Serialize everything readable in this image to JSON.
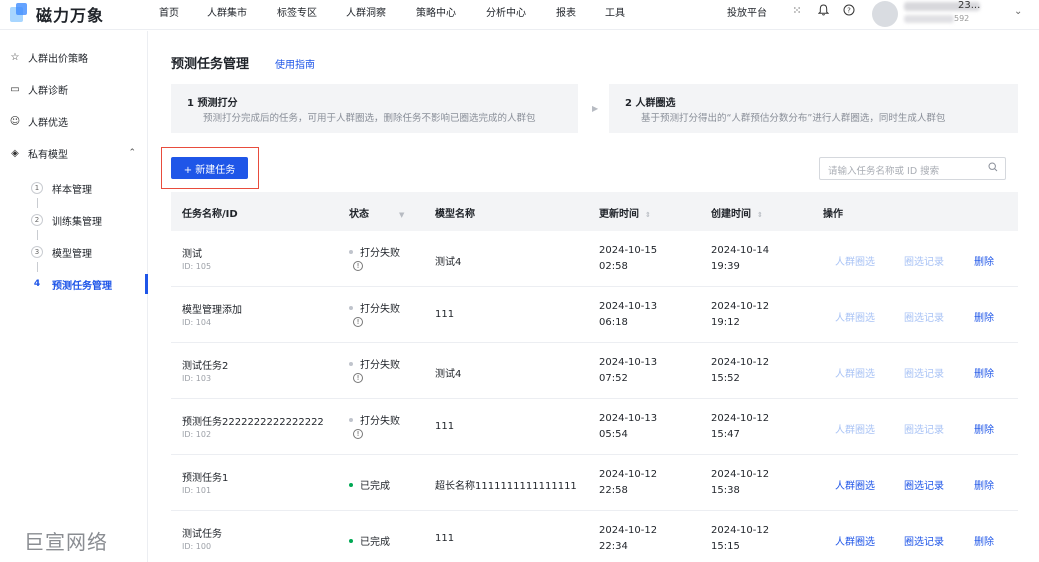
{
  "app": {
    "logo_text": "磁力万象"
  },
  "top_nav": {
    "items": [
      "首页",
      "人群集市",
      "标签专区",
      "人群洞察",
      "策略中心",
      "分析中心",
      "报表",
      "工具"
    ]
  },
  "top_right": {
    "platform_label": "投放平台",
    "icons": [
      "grid-icon",
      "bell-icon",
      "help-icon"
    ],
    "user_name_tail": "23...",
    "user_id_tail": "592"
  },
  "sidebar": {
    "items": [
      {
        "label": "人群出价策略",
        "icon": "strategy-icon"
      },
      {
        "label": "人群诊断",
        "icon": "diagnosis-icon"
      },
      {
        "label": "人群优选",
        "icon": "people-icon"
      },
      {
        "label": "私有模型",
        "icon": "layers-icon"
      }
    ],
    "sub_items": [
      {
        "num": "1",
        "label": "样本管理"
      },
      {
        "num": "2",
        "label": "训练集管理"
      },
      {
        "num": "3",
        "label": "模型管理"
      },
      {
        "num": "4",
        "label": "预测任务管理"
      }
    ],
    "watermark": "巨宣网络"
  },
  "page": {
    "title": "预测任务管理",
    "guide_link": "使用指南",
    "steps": [
      {
        "title": "1   预测打分",
        "desc": "预测打分完成后的任务，可用于人群圈选，删除任务不影响已圈选完成的人群包"
      },
      {
        "title": "2   人群圈选",
        "desc": "基于预测打分得出的“人群预估分数分布”进行人群圈选，同时生成人群包"
      }
    ],
    "new_button": "+ 新建任务",
    "search_placeholder": "请输入任务名称或 ID 搜索"
  },
  "table": {
    "headers": {
      "name": "任务名称/ID",
      "status": "状态",
      "model": "模型名称",
      "updated": "更新时间",
      "created": "创建时间",
      "actions": "操作"
    },
    "rows": [
      {
        "name": "测试",
        "id": "ID: 105",
        "status": "打分失败",
        "failed": true,
        "model": "测试4",
        "updated_date": "2024-10-15",
        "updated_time": "02:58",
        "created_date": "2024-10-14",
        "created_time": "19:39"
      },
      {
        "name": "模型管理添加",
        "id": "ID: 104",
        "status": "打分失败",
        "failed": true,
        "model": "111",
        "updated_date": "2024-10-13",
        "updated_time": "06:18",
        "created_date": "2024-10-12",
        "created_time": "19:12"
      },
      {
        "name": "测试任务2",
        "id": "ID: 103",
        "status": "打分失败",
        "failed": true,
        "model": "测试4",
        "updated_date": "2024-10-13",
        "updated_time": "07:52",
        "created_date": "2024-10-12",
        "created_time": "15:52"
      },
      {
        "name": "预测任务2222222222222222",
        "id": "ID: 102",
        "status": "打分失败",
        "failed": true,
        "model": "111",
        "updated_date": "2024-10-13",
        "updated_time": "05:54",
        "created_date": "2024-10-12",
        "created_time": "15:47"
      },
      {
        "name": "预测任务1",
        "id": "ID: 101",
        "status": "已完成",
        "failed": false,
        "model": "超长名称1111111111111111",
        "updated_date": "2024-10-12",
        "updated_time": "22:58",
        "created_date": "2024-10-12",
        "created_time": "15:38"
      },
      {
        "name": "测试任务",
        "id": "ID: 100",
        "status": "已完成",
        "failed": false,
        "model": "111",
        "updated_date": "2024-10-12",
        "updated_time": "22:34",
        "created_date": "2024-10-12",
        "created_time": "15:15"
      }
    ],
    "actions": [
      "人群圈选",
      "圈选记录",
      "删除"
    ]
  },
  "colors": {
    "primary": "#1f56e8",
    "action_disabled": "#a9c3f5",
    "status_failed": "#c0c4cc",
    "status_done": "#00a854",
    "highlight_border": "#e84c3d"
  }
}
